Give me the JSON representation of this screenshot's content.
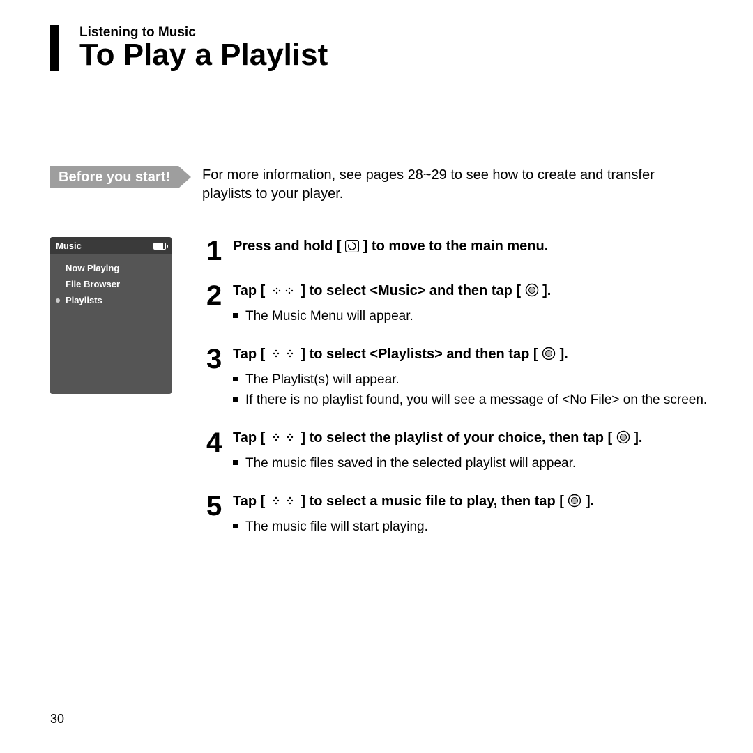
{
  "header": {
    "section": "Listening to Music",
    "title": "To Play a Playlist"
  },
  "before": {
    "label": "Before you start!",
    "text": "For more information, see pages 28~29 to see how to create and transfer playlists to your player."
  },
  "device": {
    "title": "Music",
    "items": [
      "Now Playing",
      "File Browser",
      "Playlists"
    ],
    "selected_index": 2
  },
  "steps": [
    {
      "num": "1",
      "head_pre": "Press and hold [ ",
      "icon": "back-button",
      "head_post": " ] to move to the main menu.",
      "bullets": []
    },
    {
      "num": "2",
      "head_pre": "Tap [ ",
      "icon": "left-right",
      "head_mid": " ] to select <Music> and then tap [ ",
      "icon2": "disc-button",
      "head_post": " ].",
      "bullets": [
        "The Music Menu will appear."
      ]
    },
    {
      "num": "3",
      "head_pre": "Tap [ ",
      "icon": "up-down",
      "head_mid": " ] to select <Playlists> and then tap [ ",
      "icon2": "disc-button",
      "head_post": " ].",
      "bullets": [
        "The Playlist(s) will appear.",
        "If there is no playlist found, you will see a message of <No File> on the screen."
      ]
    },
    {
      "num": "4",
      "head_pre": "Tap [ ",
      "icon": "up-down",
      "head_mid": " ] to select the playlist of your choice, then tap [ ",
      "icon2": "disc-button",
      "head_post": " ].",
      "bullets": [
        "The music files saved in the selected playlist will appear."
      ]
    },
    {
      "num": "5",
      "head_pre": "Tap [ ",
      "icon": "up-down",
      "head_mid": " ] to select a music file to play, then tap [ ",
      "icon2": "disc-button",
      "head_post": " ].",
      "bullets": [
        "The music file will start playing."
      ]
    }
  ],
  "page_number": "30"
}
